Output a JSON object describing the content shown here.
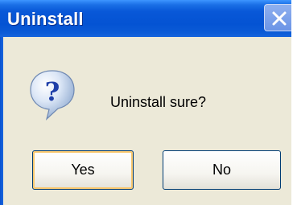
{
  "window": {
    "title": "Uninstall"
  },
  "dialog": {
    "icon": "question-icon",
    "message": "Uninstall sure?",
    "buttons": {
      "yes_label": "Yes",
      "no_label": "No"
    }
  },
  "colors": {
    "titlebar": "#0453d3",
    "dialog_bg": "#ece9d8",
    "default_button_focus": "#f9c86f",
    "icon_blue": "#2f6fe0"
  }
}
